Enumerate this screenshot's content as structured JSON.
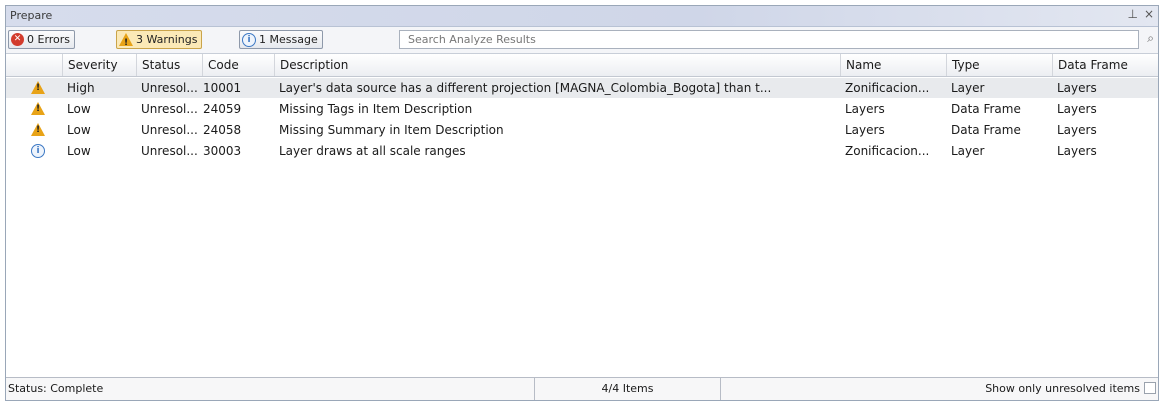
{
  "window": {
    "title": "Prepare",
    "pin_glyph": "⊥",
    "close_glyph": "×"
  },
  "toolbar": {
    "errors_label": "0 Errors",
    "warnings_label": "3 Warnings",
    "messages_label": "1 Message",
    "search_placeholder": "Search Analyze Results"
  },
  "table": {
    "columns": [
      "Severity",
      "Status",
      "Code",
      "Description",
      "Name",
      "Type",
      "Data Frame"
    ],
    "rows": [
      {
        "icon": "warning-icon",
        "severity": "High",
        "status": "Unresol...",
        "code": "10001",
        "description": "Layer's data source has a different projection [MAGNA_Colombia_Bogota] than t...",
        "name": "Zonificacion...",
        "type": "Layer",
        "data_frame": "Layers"
      },
      {
        "icon": "warning-icon",
        "severity": "Low",
        "status": "Unresol...",
        "code": "24059",
        "description": "Missing Tags in Item Description",
        "name": "Layers",
        "type": "Data Frame",
        "data_frame": "Layers"
      },
      {
        "icon": "warning-icon",
        "severity": "Low",
        "status": "Unresol...",
        "code": "24058",
        "description": "Missing Summary in Item Description",
        "name": "Layers",
        "type": "Data Frame",
        "data_frame": "Layers"
      },
      {
        "icon": "info-icon",
        "severity": "Low",
        "status": "Unresol...",
        "code": "30003",
        "description": "Layer draws at all scale ranges",
        "name": "Zonificacion...",
        "type": "Layer",
        "data_frame": "Layers"
      }
    ]
  },
  "statusbar": {
    "status": "Status: Complete",
    "count": "4/4 Items",
    "filter_label": "Show only unresolved items"
  },
  "colors": {
    "warning": "#e8a317",
    "error": "#d23b2c",
    "info": "#3c78c4"
  }
}
